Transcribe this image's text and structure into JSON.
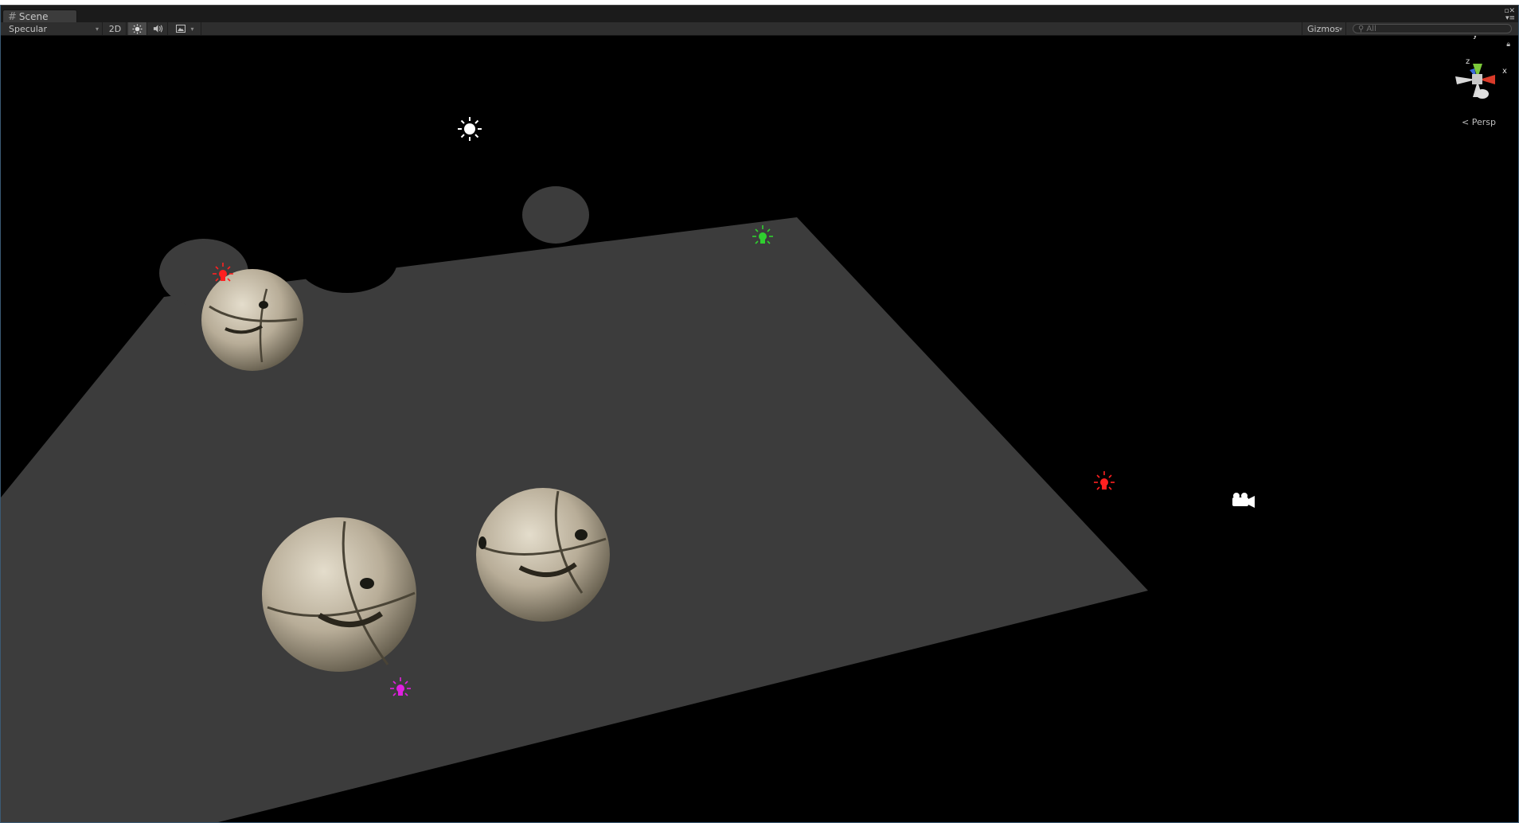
{
  "tab": {
    "label": "Scene",
    "icon": "scene-grid-icon"
  },
  "toolbar": {
    "render_mode": "Specular",
    "mode_2d": "2D",
    "lighting_icon": "sun-icon",
    "audio_icon": "speaker-icon",
    "effects_icon": "image-icon",
    "gizmos": "Gizmos",
    "search_placeholder": "All"
  },
  "gizmo": {
    "x": "x",
    "y": "y",
    "z": "z",
    "projection": "Persp"
  },
  "colors": {
    "floor": "#3d3d3d",
    "red_light": "#ff2020",
    "green_light": "#2fd02f",
    "magenta_light": "#e020e0",
    "directional_light": "#ffffff"
  },
  "scene_objects": [
    "directional-light-icon",
    "point-light-red-icon",
    "point-light-green-icon",
    "point-light-red-icon",
    "point-light-magenta-icon",
    "camera-icon",
    "stone-sphere"
  ]
}
